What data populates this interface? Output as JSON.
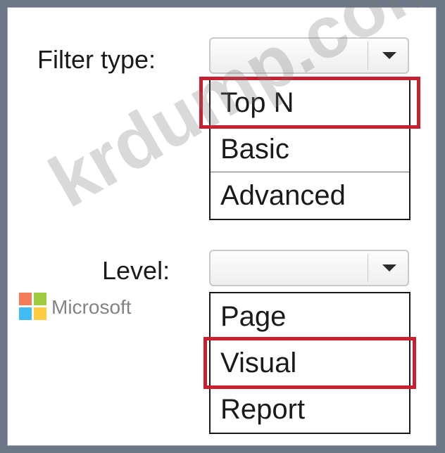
{
  "filter_type": {
    "label": "Filter type:",
    "selected_value": "",
    "options": [
      "Top N",
      "Basic",
      "Advanced"
    ],
    "highlighted_option": "Top N"
  },
  "level": {
    "label": "Level:",
    "selected_value": "",
    "options": [
      "Page",
      "Visual",
      "Report"
    ],
    "highlighted_option": "Visual"
  },
  "watermark": {
    "site": "krdump.com",
    "brand": "Microsoft"
  },
  "colors": {
    "highlight": "#c8202e",
    "frame": "#6b7686"
  },
  "icons": {
    "dropdown": "chevron-down-icon",
    "logo": "microsoft-logo-icon"
  }
}
